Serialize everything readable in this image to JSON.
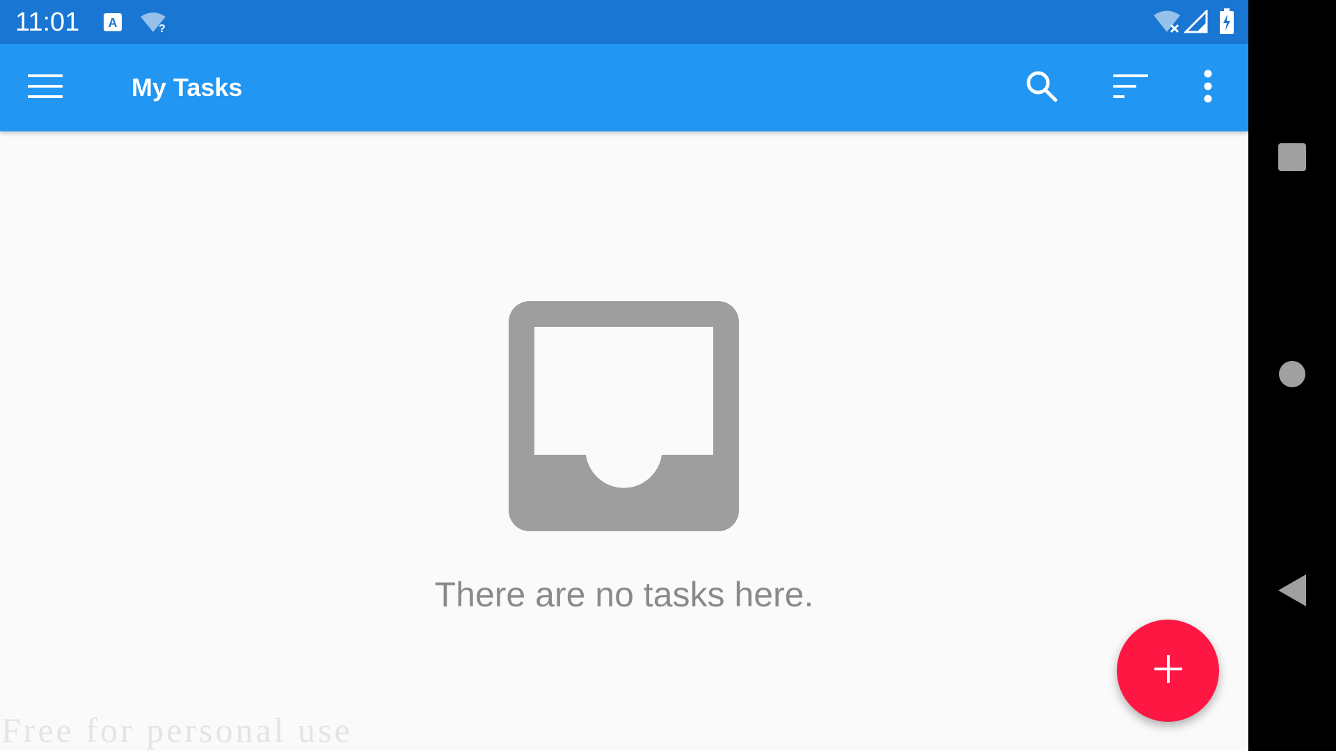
{
  "status_bar": {
    "time": "11:01",
    "icons": [
      "accessibility-a-icon",
      "wifi-question-icon",
      "wifi-off-icon",
      "cell-signal-icon",
      "battery-charging-icon"
    ]
  },
  "app_bar": {
    "title": "My Tasks",
    "actions": [
      "menu-icon",
      "search-icon",
      "sort-icon",
      "more-vert-icon"
    ]
  },
  "empty_state": {
    "icon": "inbox-icon",
    "message": "There are no tasks here."
  },
  "fab": {
    "icon": "plus-icon",
    "color": "#ff1744"
  },
  "watermark": "Free for personal use",
  "nav_bar": {
    "buttons": [
      "recents-square-icon",
      "home-circle-icon",
      "back-triangle-icon"
    ]
  },
  "colors": {
    "status_bar": "#1976d2",
    "app_bar": "#2196f3",
    "background": "#fafafa",
    "empty_icon": "#9e9e9e",
    "empty_text": "#8a8a8a",
    "fab": "#ff1744"
  }
}
